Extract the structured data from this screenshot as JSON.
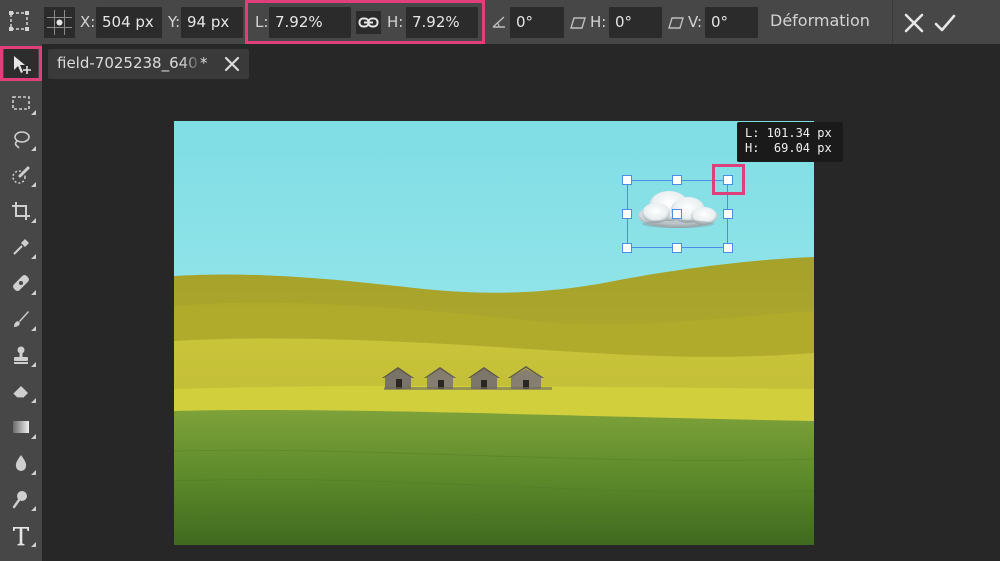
{
  "options_bar": {
    "x_label": "X:",
    "x_value": "504 px",
    "y_label": "Y:",
    "y_value": "94 px",
    "width_label": "L:",
    "width_value": "7.92%",
    "height_label": "H:",
    "height_value": "7.92%",
    "angle_value": "0°",
    "skew_h_label": "H:",
    "skew_h_value": "0°",
    "skew_v_label": "V:",
    "skew_v_value": "0°",
    "warp_label": "Déformation"
  },
  "document_tab": {
    "name": "field-7025238_640",
    "modified_mark": "*"
  },
  "size_readout": {
    "width_line": "L: 101.34 px",
    "height_line": "H:  69.04 px"
  },
  "toolbar": {
    "tools": [
      "move-tool",
      "marquee-tool",
      "lasso-tool",
      "quick-select-tool",
      "crop-tool",
      "eyedropper-tool",
      "healing-tool",
      "brush-tool",
      "clone-stamp-tool",
      "eraser-tool",
      "gradient-tool",
      "blur-tool",
      "dodge-tool",
      "text-tool"
    ],
    "active_tool": "move-tool"
  },
  "colors": {
    "highlight": "#e0407a",
    "selection": "#4c8ee6",
    "sky": "#8fe4ea",
    "field_yellow": "#b8b830",
    "field_green": "#5f8a2a"
  }
}
